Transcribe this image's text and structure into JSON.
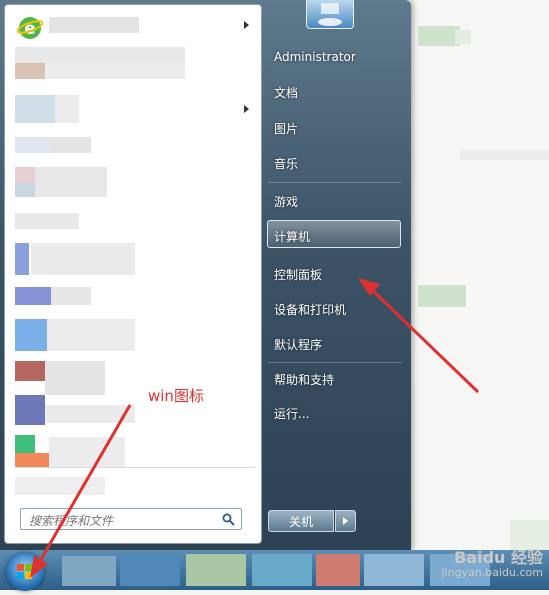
{
  "start_menu": {
    "right_items": [
      {
        "label": "Administrator"
      },
      {
        "label": "文档"
      },
      {
        "label": "图片"
      },
      {
        "label": "音乐"
      },
      {
        "label": "游戏"
      },
      {
        "label": "计算机"
      },
      {
        "label": "控制面板"
      },
      {
        "label": "设备和打印机"
      },
      {
        "label": "默认程序"
      },
      {
        "label": "帮助和支持"
      },
      {
        "label": "运行..."
      }
    ],
    "search_placeholder": "搜索程序和文件",
    "shutdown_label": "关机"
  },
  "annotation": {
    "label": "win图标",
    "color": "#e03030"
  },
  "watermark": {
    "brand": "Baidu 经验",
    "url": "jingyan.baidu.com"
  },
  "icons": [
    "ie-icon",
    "search-icon",
    "windows-logo-icon",
    "shutdown-options-icon"
  ]
}
